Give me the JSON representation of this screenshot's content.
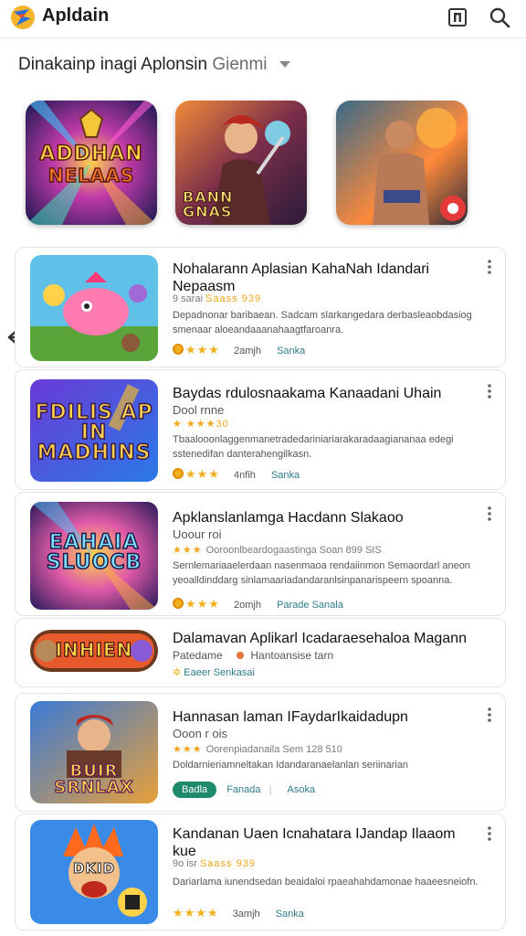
{
  "header": {
    "title": "Apldain",
    "icons": [
      "app-logo-icon",
      "grid-icon",
      "search-icon"
    ]
  },
  "category": {
    "label": "Dinakainp inagi Aplonsin",
    "muted": "Gienmi"
  },
  "featured": [
    {
      "label_line1": "ADDHAN",
      "label_line2": "NELAAS",
      "palette": "neon"
    },
    {
      "label_line1": "BANN",
      "label_line2": "GNAS",
      "palette": "warrior"
    },
    {
      "label_line1": "",
      "label_line2": "",
      "palette": "brawler"
    }
  ],
  "list": [
    {
      "title": "Nohalarann Aplasian KahaNah Idandari Nepaasm",
      "meta": "9 sarai",
      "meta2": "Saass 939",
      "desc": "Depadnonar baribaean. Sadcam slarkangedara derbasleaobdasiog smenaar aloeandaaanahaagtfaroanra.",
      "stars": "★★★",
      "downloads": "2amjh",
      "tag": "Sanka",
      "thumb_label": ""
    },
    {
      "title": "Baydas rdulosnaakama Kanaadani Uhain",
      "meta": "Dool rnne",
      "meta2": "★ ★★★30",
      "desc": "Tbaalooonlaggenmanetradedariniariarakaradaagiananaa edegi sstenedifan danterahengilkasn.",
      "stars": "★★★",
      "downloads": "4nfih",
      "tag": "Sanka",
      "thumb_label": "FDILIS AP IN MADHINS"
    },
    {
      "title": "Apklanslanlamga Hacdann Slakaoo",
      "meta": "Uoour roi",
      "meta2": "Ooroonlbeardogaastinga Soan 899 SIS",
      "desc": "Sernlemariaaelerdaan nasenmaoa rendaiinmon Semaordarl aneon yeoalldinddarg sinlamaariadandaranlsinpanarispeern spoanna.",
      "stars": "★★★",
      "downloads": "2omjh",
      "tag": "Parade Sanala",
      "thumb_label": "EAHAIA SLUOCB"
    },
    {
      "title": "Dalamavan Aplikarl Icadaraesehaloa Magann",
      "meta": "Patedame",
      "meta2": "Hantoansise tarn",
      "desc": "",
      "stars": "",
      "downloads": "",
      "tag": "Eaeer Senkasai",
      "thumb_label": "INHIEN"
    },
    {
      "title": "Hannasan laman IFaydarIkaidadupn",
      "meta": "Ooon r ois",
      "meta2": "Oorenpiadanaila Sem 128 510",
      "desc": "Doldarnieriamneltakan Idandaranaelanlan seriinarian",
      "stars": "",
      "downloads": "Fanada",
      "tag": "Asoka",
      "pill": "Badla",
      "thumb_label": "BUIR SRNLAX"
    },
    {
      "title": "Kandanan Uaen Icnahatara IJandap Ilaaom kue",
      "meta": "9o isr",
      "meta2": "Saass 939",
      "desc": "Dariarlama iunendsedan beaidaloi rpaeahahdamonae haaeesneiofn.",
      "stars": "★★★★",
      "downloads": "3amjh",
      "tag": "Sanka",
      "thumb_label": "DKID"
    }
  ],
  "colors": {
    "accent": "#1e8a6a",
    "star": "#f2b01e",
    "tag": "#2e7d8a"
  }
}
